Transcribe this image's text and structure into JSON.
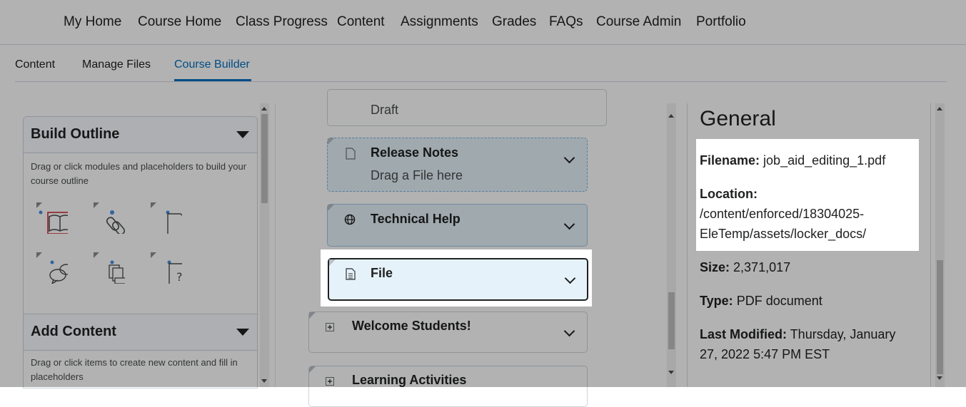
{
  "nav": [
    "My Home",
    "Course Home",
    "Class Progress",
    "Content",
    "Assignments",
    "Grades",
    "FAQs",
    "Course Admin",
    "Portfolio"
  ],
  "subtabs": [
    "Content",
    "Manage Files",
    "Course Builder"
  ],
  "build_outline": {
    "title": "Build Outline",
    "description": "Drag or click modules and placeholders to build your course outline",
    "tools": [
      "book-icon",
      "link-icon",
      "document-icon",
      "discussion-icon",
      "multi-file-icon",
      "quiz-icon"
    ]
  },
  "add_content": {
    "title": "Add Content",
    "description": "Drag or click items to create new content and fill in placeholders"
  },
  "outline": {
    "draft": "Draft",
    "items": [
      {
        "label": "Release Notes",
        "sub": "Drag a File here"
      },
      {
        "label": "Technical Help"
      },
      {
        "label": "File"
      },
      {
        "label": "Welcome Students!"
      },
      {
        "label": "Learning Activities"
      }
    ]
  },
  "properties": {
    "heading": "General",
    "filename_label": "Filename:",
    "filename": "job_aid_editing_1.pdf",
    "location_label": "Location:",
    "location_line1": "/content/enforced/18304025-",
    "location_line2": "EleTemp/assets/locker_docs/",
    "size_label": "Size:",
    "size": "2,371,017",
    "type_label": "Type:",
    "type": "PDF document",
    "modified_label": "Last Modified:",
    "modified_line1": "Thursday, January",
    "modified_line2": "27, 2022 5:47 PM EST"
  },
  "colors": {
    "accent": "#006fbf",
    "highlight_card": "#e6f2fa",
    "dashed_card": "#e6f2fa"
  }
}
